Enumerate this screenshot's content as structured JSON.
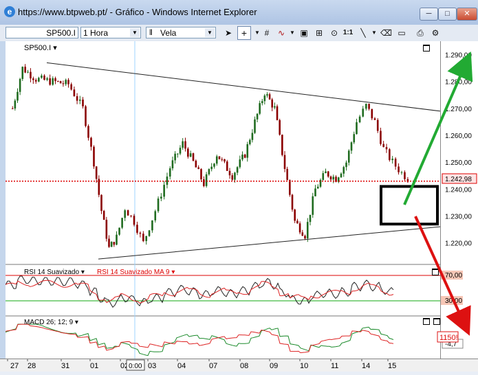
{
  "window": {
    "title": "https://www.btpweb.pt/ - Gráfico - Windows Internet Explorer",
    "minimize": "─",
    "maximize": "□",
    "close": "✕"
  },
  "toolbar": {
    "symbol": "SP500.I",
    "interval": "1 Hora",
    "chart_style": "Vela",
    "ratio_label": "1:1"
  },
  "panels": {
    "price_label": "SP500.I ▾",
    "rsi_label": "RSI 14 Suavizado ▾",
    "rsi_ma_label": "RSI 14 Suavizado MA 9 ▾",
    "macd_label": "MACD 26; 12; 9 ▾"
  },
  "price_axis": {
    "ticks": [
      "1.290,00",
      "1.280,00",
      "1.270,00",
      "1.260,00",
      "1.250,00",
      "1.240,00",
      "1.230,00",
      "1.220,00"
    ],
    "current_price": "1.242,98"
  },
  "rsi_axis": {
    "upper": "70,00",
    "lower": "30,00"
  },
  "macd_axis": {
    "value": "-4,7"
  },
  "date_axis": {
    "labels": [
      "27",
      "28",
      "31",
      "01",
      "02",
      "03",
      "04",
      "07",
      "08",
      "09",
      "10",
      "11",
      "14",
      "15"
    ],
    "cursor_time": "0:00"
  },
  "annotation": {
    "target_label": "1150!"
  },
  "colors": {
    "up_candle": "#1f6b1f",
    "down_candle": "#8b0000",
    "current_price_line": "#dd0000",
    "arrow_up": "#22aa33",
    "arrow_down": "#dd1111",
    "rsi_upper": "#dd0000",
    "rsi_lower": "#11aa11"
  },
  "chart_data": {
    "type": "candlestick",
    "symbol": "SP500.I",
    "interval": "1 Hora",
    "ylim": [
      1212,
      1295
    ],
    "x": [
      "27",
      "28",
      "31",
      "01",
      "02",
      "03",
      "04",
      "07",
      "08",
      "09",
      "10",
      "11",
      "14",
      "15"
    ],
    "close_path": [
      [
        "27",
        1270
      ],
      [
        "27",
        1285
      ],
      [
        "28",
        1281
      ],
      [
        "28",
        1280
      ],
      [
        "31",
        1279
      ],
      [
        "31",
        1270
      ],
      [
        "01",
        1250
      ],
      [
        "01",
        1232
      ],
      [
        "01",
        1218
      ],
      [
        "01",
        1222
      ],
      [
        "02",
        1233
      ],
      [
        "02",
        1228
      ],
      [
        "02",
        1220
      ],
      [
        "03",
        1232
      ],
      [
        "03",
        1248
      ],
      [
        "04",
        1257
      ],
      [
        "04",
        1250
      ],
      [
        "04",
        1242
      ],
      [
        "07",
        1253
      ],
      [
        "07",
        1245
      ],
      [
        "08",
        1253
      ],
      [
        "08",
        1265
      ],
      [
        "08",
        1276
      ],
      [
        "09",
        1270
      ],
      [
        "09",
        1248
      ],
      [
        "09",
        1228
      ],
      [
        "10",
        1223
      ],
      [
        "10",
        1240
      ],
      [
        "10",
        1246
      ],
      [
        "11",
        1244
      ],
      [
        "11",
        1250
      ],
      [
        "11",
        1265
      ],
      [
        "14",
        1271
      ],
      [
        "14",
        1265
      ],
      [
        "14",
        1255
      ],
      [
        "15",
        1250
      ],
      [
        "15",
        1246
      ],
      [
        "15",
        1243
      ]
    ],
    "current_price": 1242.98,
    "trendlines": [
      {
        "name": "upper",
        "from": [
          "28",
          1287
        ],
        "to": [
          "15+",
          1269
        ]
      },
      {
        "name": "lower",
        "from": [
          "01",
          1214
        ],
        "to": [
          "15+",
          1226
        ]
      }
    ],
    "indicators": {
      "rsi": {
        "period": 14,
        "ma": 9,
        "levels": [
          70,
          30
        ]
      },
      "macd": {
        "slow": 26,
        "fast": 12,
        "signal": 9,
        "last": -4.7
      }
    },
    "annotations": {
      "target_box": [
        1227,
        1241
      ],
      "upside_target": 1292,
      "downside_target": "1150!"
    }
  }
}
